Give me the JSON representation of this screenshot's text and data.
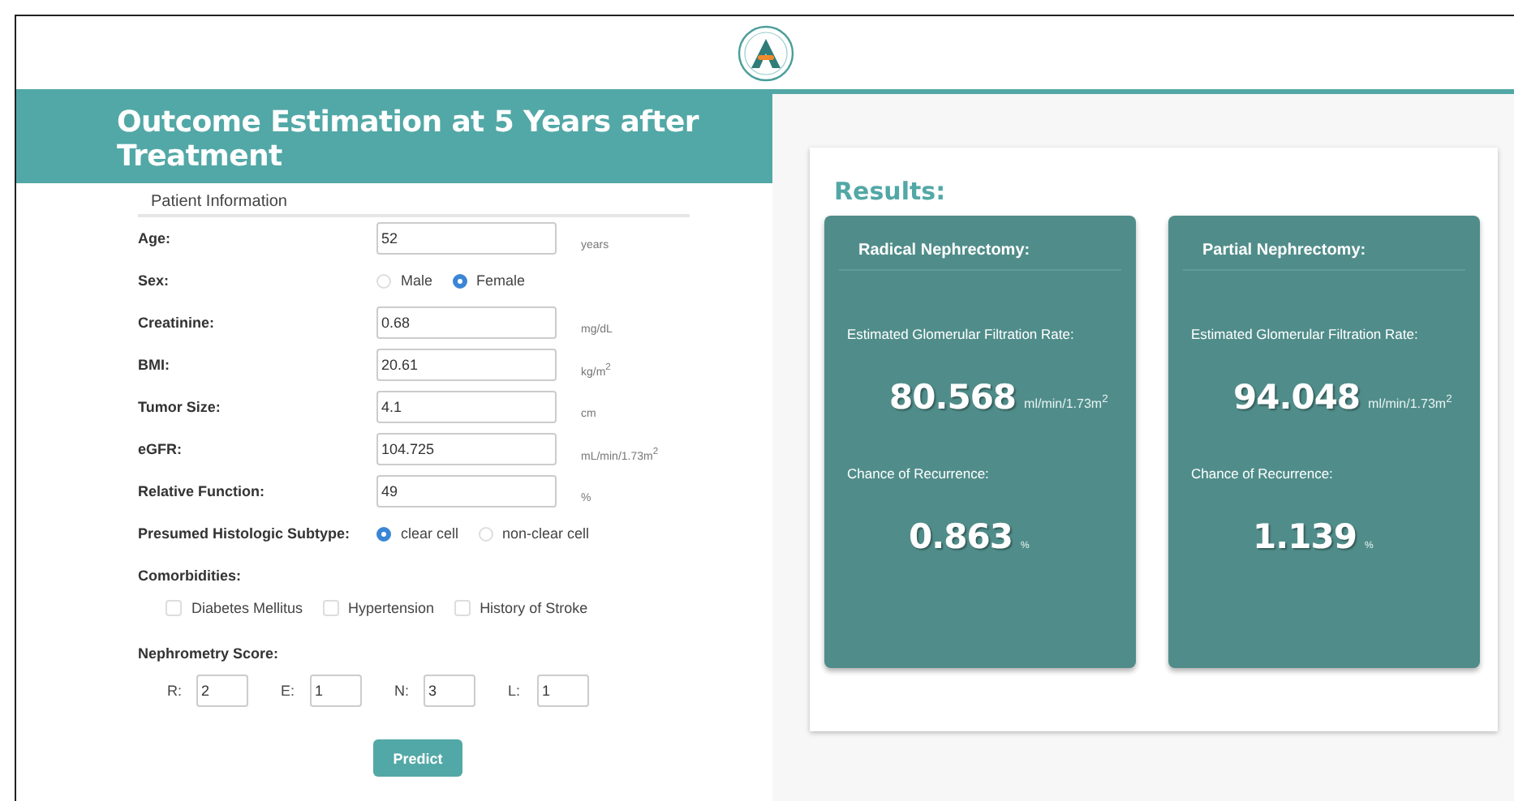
{
  "header": {
    "title": "Outcome Estimation at 5 Years after Treatment"
  },
  "form": {
    "section": "Patient Information",
    "rows": [
      {
        "kind": "input",
        "label": "Age:",
        "value": "52",
        "unit": "years"
      },
      {
        "kind": "radio",
        "label": "Sex:",
        "options": [
          {
            "label": "Male",
            "selected": false
          },
          {
            "label": "Female",
            "selected": true
          }
        ]
      },
      {
        "kind": "input",
        "label": "Creatinine:",
        "value": "0.68",
        "unit": "mg/dL"
      },
      {
        "kind": "input",
        "label": "BMI:",
        "value": "20.61",
        "unit": "kg/m$^{2}$"
      },
      {
        "kind": "input",
        "label": "Tumor Size:",
        "value": "4.1",
        "unit": "cm"
      },
      {
        "kind": "input",
        "label": "eGFR:",
        "value": "104.725",
        "unit": "mL/min/1.73m$^{2}$"
      },
      {
        "kind": "input",
        "label": "Relative Function:",
        "value": "49",
        "unit": "%"
      },
      {
        "kind": "radio",
        "label": "Presumed Histologic Subtype:",
        "options": [
          {
            "label": "clear cell",
            "selected": true
          },
          {
            "label": "non-clear cell",
            "selected": false
          }
        ]
      }
    ],
    "comorbidities": {
      "label": "Comorbidities:",
      "items": [
        {
          "label": "Diabetes Mellitus",
          "checked": false
        },
        {
          "label": "Hypertension",
          "checked": false
        },
        {
          "label": "History of Stroke",
          "checked": false
        }
      ]
    },
    "nephrometry": {
      "label": "Nephrometry Score:",
      "items": [
        {
          "label": "R:",
          "value": "2"
        },
        {
          "label": "E:",
          "value": "1"
        },
        {
          "label": "N:",
          "value": "3"
        },
        {
          "label": "L:",
          "value": "1"
        }
      ]
    },
    "button": "Predict"
  },
  "results": {
    "title": "Results:",
    "cards": [
      {
        "title": "Radical Nephrectomy:",
        "metrics": [
          {
            "label": "Estimated Glomerular Filtration Rate:",
            "value": "80.568",
            "unit": "ml/min/1.73m$^{2}$"
          },
          {
            "label": "Chance of Recurrence:",
            "value": "0.863",
            "unit": "%"
          }
        ]
      },
      {
        "title": "Partial Nephrectomy:",
        "metrics": [
          {
            "label": "Estimated Glomerular Filtration Rate:",
            "value": "94.048",
            "unit": "ml/min/1.73m$^{2}$"
          },
          {
            "label": "Chance of Recurrence:",
            "value": "1.139",
            "unit": "%"
          }
        ]
      }
    ]
  }
}
